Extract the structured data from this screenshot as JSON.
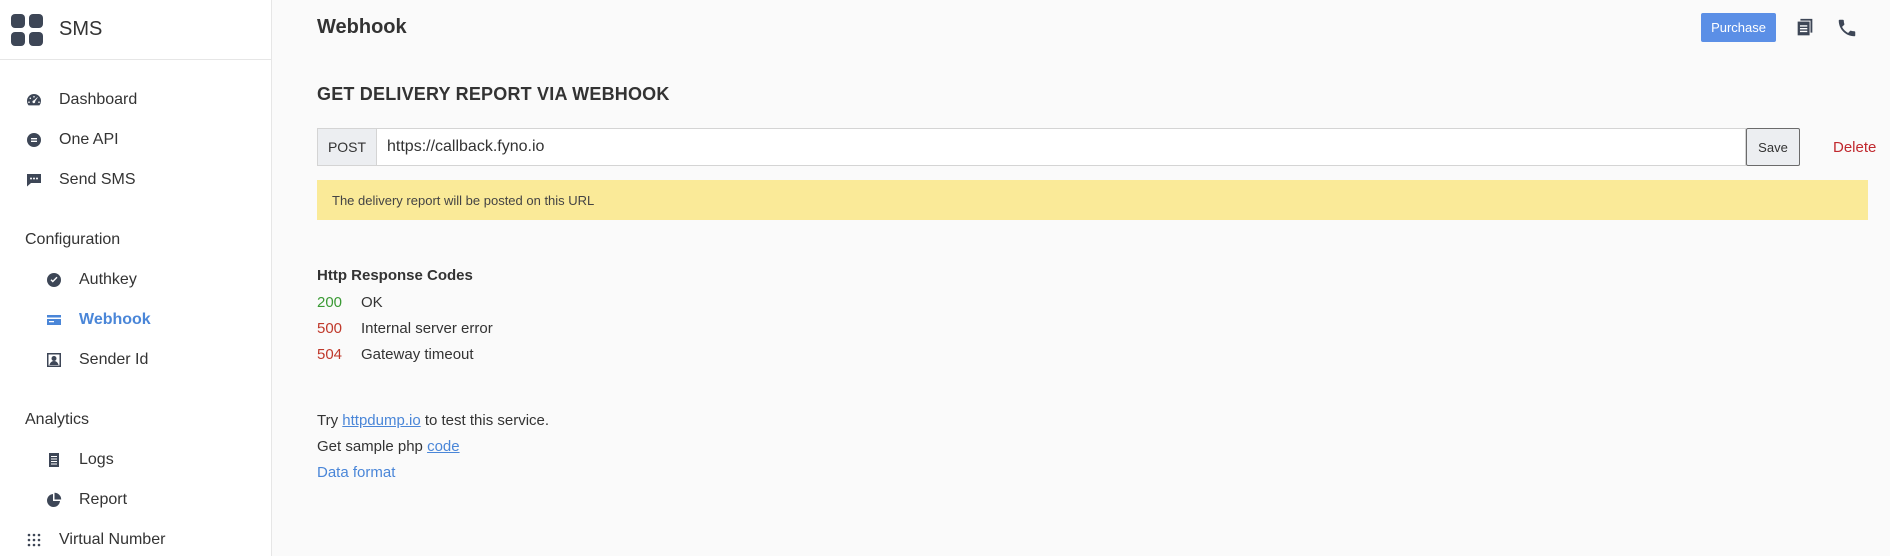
{
  "brand": {
    "title": "SMS"
  },
  "sidebar": {
    "items": [
      {
        "label": "Dashboard",
        "icon": "gauge-icon"
      },
      {
        "label": "One API",
        "icon": "api-icon"
      },
      {
        "label": "Send SMS",
        "icon": "chat-icon"
      }
    ],
    "configuration": {
      "label": "Configuration",
      "items": [
        {
          "label": "Authkey",
          "icon": "check-circle-icon"
        },
        {
          "label": "Webhook",
          "icon": "webhook-card-icon",
          "active": true
        },
        {
          "label": "Sender Id",
          "icon": "sender-id-icon"
        }
      ]
    },
    "analytics": {
      "label": "Analytics",
      "items": [
        {
          "label": "Logs",
          "icon": "logs-icon"
        },
        {
          "label": "Report",
          "icon": "pie-chart-icon"
        }
      ]
    },
    "virtual_number": {
      "label": "Virtual Number",
      "icon": "grid-dots-icon"
    }
  },
  "header": {
    "title": "Webhook",
    "purchase_label": "Purchase",
    "icons": [
      "docs-icon",
      "phone-icon"
    ]
  },
  "webhook": {
    "heading": "GET DELIVERY REPORT VIA WEBHOOK",
    "method": "POST",
    "url": "https://callback.fyno.io",
    "save_label": "Save",
    "delete_label": "Delete",
    "notice": "The delivery report will be posted on this URL"
  },
  "response_codes": {
    "title": "Http Response Codes",
    "codes": [
      {
        "code": "200",
        "text": "OK"
      },
      {
        "code": "500",
        "text": "Internal server error"
      },
      {
        "code": "504",
        "text": "Gateway timeout"
      }
    ]
  },
  "help": {
    "try_prefix": "Try ",
    "try_link": "httpdump.io",
    "try_suffix": " to test this service.",
    "sample_prefix": "Get sample php ",
    "sample_link": "code",
    "data_format": "Data format"
  },
  "colors": {
    "accent": "#4a86d8",
    "purchase": "#5b8fe6",
    "notice_bg": "#faea98",
    "ok": "#3a9a34",
    "error": "#c0392b",
    "delete": "#c0282e"
  }
}
